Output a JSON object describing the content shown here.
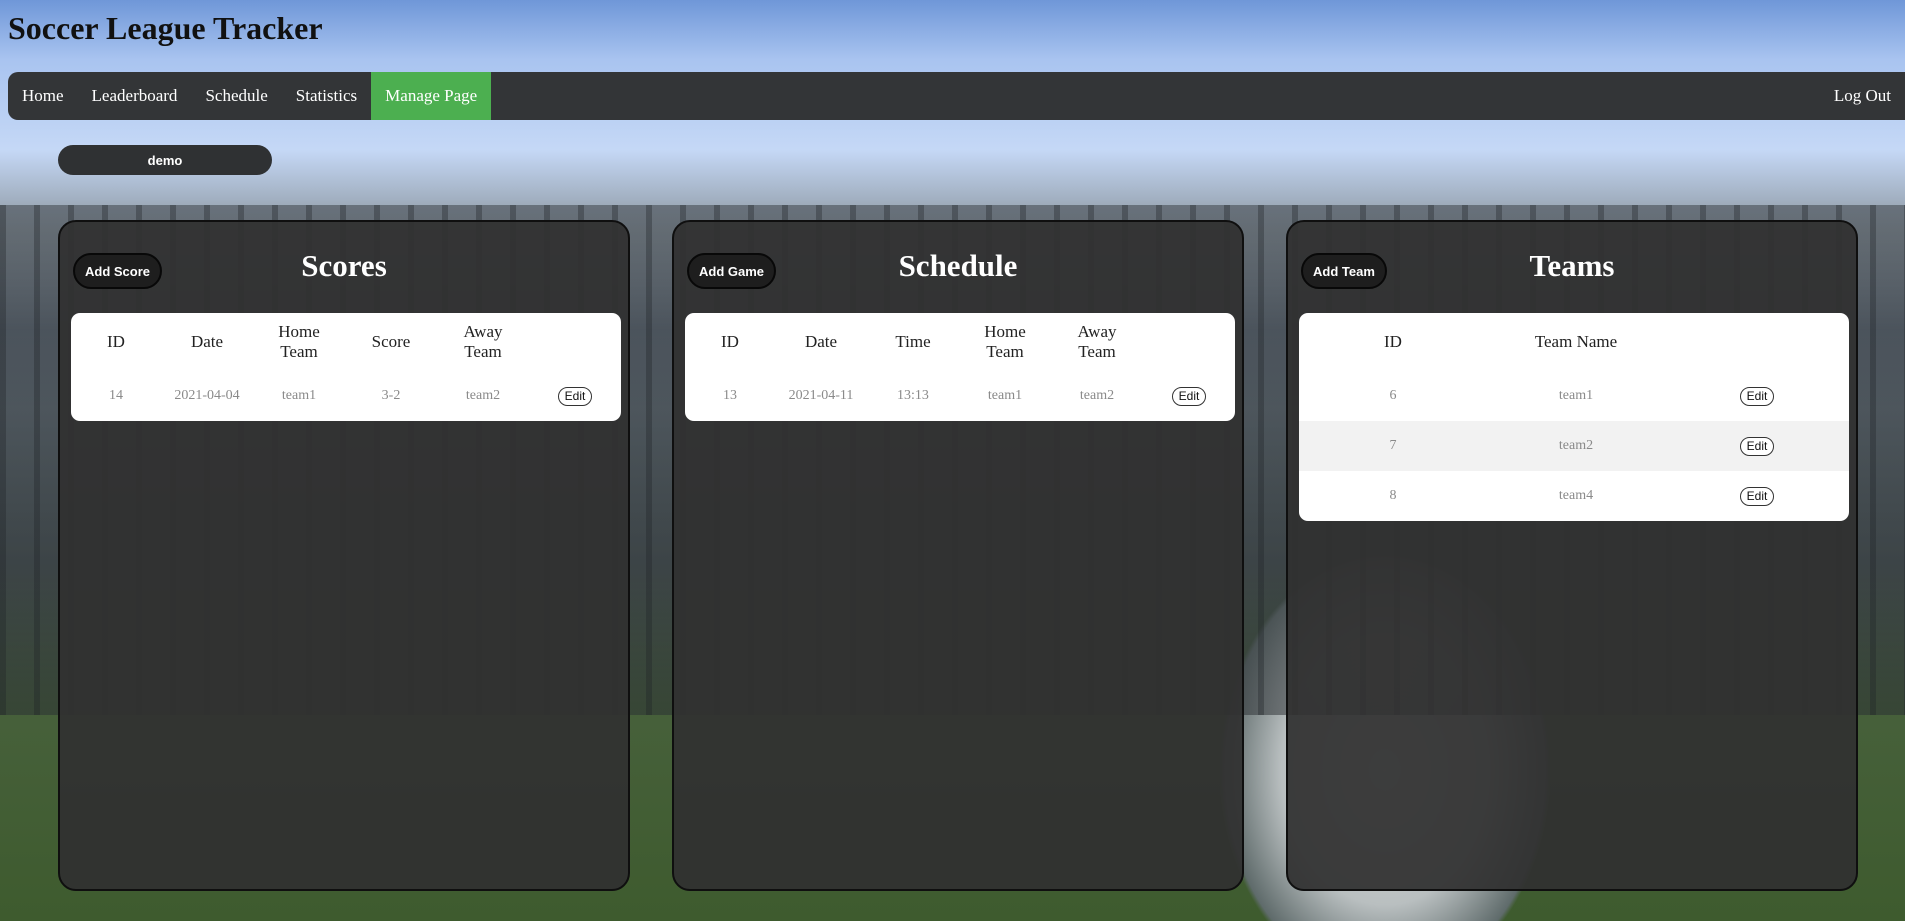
{
  "app": {
    "title": "Soccer League Tracker"
  },
  "nav": {
    "items": [
      {
        "label": "Home"
      },
      {
        "label": "Leaderboard"
      },
      {
        "label": "Schedule"
      },
      {
        "label": "Statistics"
      },
      {
        "label": "Manage Page",
        "active": true
      }
    ],
    "logout_label": "Log Out",
    "active_color": "#4caf50",
    "bar_color": "#333537"
  },
  "user": {
    "name": "demo"
  },
  "scores": {
    "title": "Scores",
    "add_label": "Add Score",
    "headers": [
      "ID",
      "Date",
      "Home Team",
      "Score",
      "Away Team",
      ""
    ],
    "rows": [
      {
        "id": "14",
        "date": "2021-04-04",
        "home": "team1",
        "score": "3-2",
        "away": "team2",
        "edit": "Edit"
      }
    ]
  },
  "schedule": {
    "title": "Schedule",
    "add_label": "Add Game",
    "headers": [
      "ID",
      "Date",
      "Time",
      "Home Team",
      "Away Team",
      ""
    ],
    "rows": [
      {
        "id": "13",
        "date": "2021-04-11",
        "time": "13:13",
        "home": "team1",
        "away": "team2",
        "edit": "Edit"
      }
    ]
  },
  "teams": {
    "title": "Teams",
    "add_label": "Add Team",
    "headers": [
      "ID",
      "Team Name",
      ""
    ],
    "rows": [
      {
        "id": "6",
        "name": "team1",
        "edit": "Edit"
      },
      {
        "id": "7",
        "name": "team2",
        "edit": "Edit"
      },
      {
        "id": "8",
        "name": "team4",
        "edit": "Edit"
      }
    ]
  }
}
